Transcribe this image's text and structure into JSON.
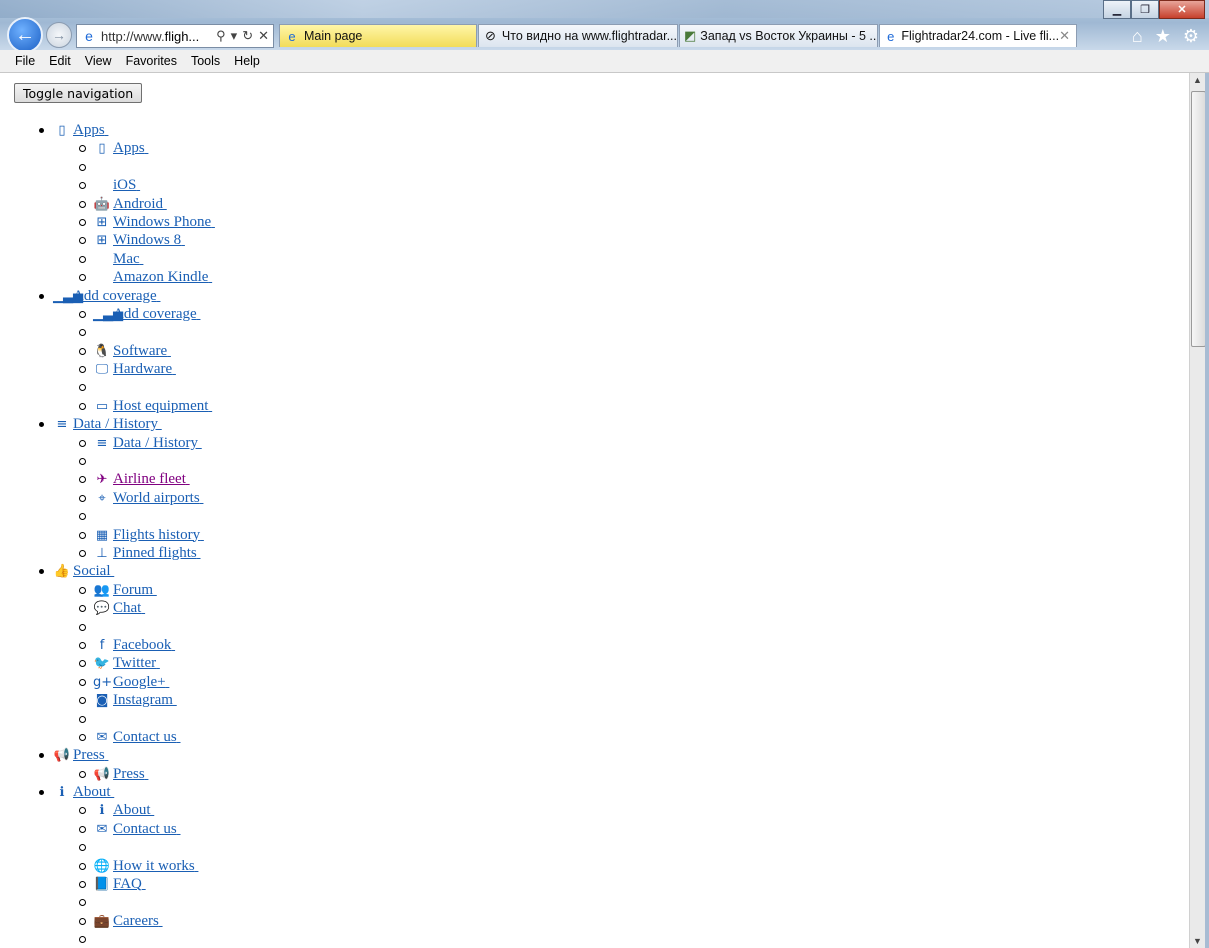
{
  "browser": {
    "window_controls": {
      "minimize": "▁",
      "maximize": "❐",
      "close": "✕"
    },
    "back_icon": "←",
    "forward_icon": "→",
    "address": {
      "prefix": "http://www.",
      "domain": "fligh...",
      "search": "⚲",
      "dropdown": "▾",
      "refresh": "↻",
      "stop": "✕"
    },
    "tabs": [
      {
        "title": "Main page",
        "icon": "ie-icon"
      },
      {
        "title": "Что видно на www.flightradar...",
        "icon": "radar-icon"
      },
      {
        "title": "Запад vs Восток Украины - 5 ...",
        "icon": "map-icon"
      },
      {
        "title": "Flightradar24.com - Live fli...",
        "icon": "ie-icon",
        "close": "✕"
      }
    ],
    "toolbar_icons": {
      "home": "⌂",
      "favorites": "★",
      "settings": "⚙"
    }
  },
  "menu": [
    "File",
    "Edit",
    "View",
    "Favorites",
    "Tools",
    "Help"
  ],
  "page": {
    "toggle_navigation": "Toggle navigation",
    "nav": [
      {
        "label": "Apps",
        "icon": "mobile-icon",
        "glyph": "▯",
        "children": [
          {
            "label": "Apps",
            "icon": "mobile-icon",
            "glyph": "▯"
          },
          {
            "label": "",
            "icon": ""
          },
          {
            "label": "iOS",
            "icon": "apple-icon",
            "glyph": ""
          },
          {
            "label": "Android",
            "icon": "android-icon",
            "glyph": "🤖"
          },
          {
            "label": "Windows Phone",
            "icon": "windows-icon",
            "glyph": "⊞"
          },
          {
            "label": "Windows 8",
            "icon": "windows-icon",
            "glyph": "⊞"
          },
          {
            "label": "Mac",
            "icon": "apple-icon",
            "glyph": ""
          },
          {
            "label": "Amazon Kindle",
            "icon": "",
            "glyph": ""
          }
        ]
      },
      {
        "label": "Add coverage",
        "icon": "signal-icon",
        "glyph": "▁▃▅",
        "children": [
          {
            "label": "Add coverage",
            "icon": "signal-icon",
            "glyph": "▁▃▅"
          },
          {
            "label": "",
            "icon": ""
          },
          {
            "label": "Software",
            "icon": "linux-icon",
            "glyph": "🐧"
          },
          {
            "label": "Hardware",
            "icon": "desktop-icon",
            "glyph": "🖵"
          },
          {
            "label": "",
            "icon": ""
          },
          {
            "label": "Host equipment",
            "icon": "inbox-icon",
            "glyph": "▭"
          }
        ]
      },
      {
        "label": "Data / History",
        "icon": "database-icon",
        "glyph": "≡",
        "children": [
          {
            "label": "Data / History",
            "icon": "database-icon",
            "glyph": "≡"
          },
          {
            "label": "",
            "icon": ""
          },
          {
            "label": "Airline fleet",
            "icon": "plane-icon",
            "glyph": "✈",
            "visited": true
          },
          {
            "label": "World airports",
            "icon": "map-marker-icon",
            "glyph": "⌖"
          },
          {
            "label": "",
            "icon": ""
          },
          {
            "label": "Flights history",
            "icon": "calendar-icon",
            "glyph": "▦"
          },
          {
            "label": "Pinned flights",
            "icon": "pin-icon",
            "glyph": "⊥"
          }
        ]
      },
      {
        "label": "Social",
        "icon": "thumbs-up-icon",
        "glyph": "👍",
        "children": [
          {
            "label": "Forum",
            "icon": "users-icon",
            "glyph": "👥"
          },
          {
            "label": "Chat",
            "icon": "comments-icon",
            "glyph": "💬"
          },
          {
            "label": "",
            "icon": ""
          },
          {
            "label": "Facebook",
            "icon": "facebook-icon",
            "glyph": "f"
          },
          {
            "label": "Twitter",
            "icon": "twitter-icon",
            "glyph": "🐦"
          },
          {
            "label": "Google+",
            "icon": "google-plus-icon",
            "glyph": "g+"
          },
          {
            "label": "Instagram",
            "icon": "instagram-icon",
            "glyph": "◙"
          },
          {
            "label": "",
            "icon": ""
          },
          {
            "label": "Contact us",
            "icon": "envelope-icon",
            "glyph": "✉"
          }
        ]
      },
      {
        "label": "Press",
        "icon": "bullhorn-icon",
        "glyph": "📢",
        "children": [
          {
            "label": "Press",
            "icon": "bullhorn-icon",
            "glyph": "📢"
          }
        ]
      },
      {
        "label": "About",
        "icon": "info-icon",
        "glyph": "ℹ",
        "children": [
          {
            "label": "About",
            "icon": "info-icon",
            "glyph": "ℹ"
          },
          {
            "label": "Contact us",
            "icon": "envelope-outline-icon",
            "glyph": "✉"
          },
          {
            "label": "",
            "icon": ""
          },
          {
            "label": "How it works",
            "icon": "globe-icon",
            "glyph": "🌐"
          },
          {
            "label": "FAQ",
            "icon": "book-icon",
            "glyph": "📘"
          },
          {
            "label": "",
            "icon": ""
          },
          {
            "label": "Careers",
            "icon": "briefcase-icon",
            "glyph": "💼"
          },
          {
            "label": "",
            "icon": ""
          }
        ]
      }
    ]
  },
  "colors": {
    "link": "#1a5fb4",
    "visited": "#800080",
    "tab_highlight": "#f2dc59"
  }
}
